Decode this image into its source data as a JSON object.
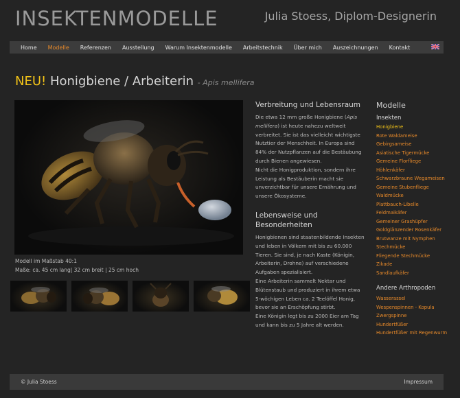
{
  "site": {
    "title": "INSEKTENMODELLE",
    "subtitle": "Julia Stoess, Diplom-Designerin"
  },
  "nav": {
    "items": [
      "Home",
      "Modelle",
      "Referenzen",
      "Ausstellung",
      "Warum Insektenmodelle",
      "Arbeitstechnik",
      "Über mich",
      "Auszeichnungen",
      "Kontakt"
    ],
    "active": "Modelle",
    "flag_icon": "uk-flag-icon"
  },
  "headline": {
    "badge": "NEU!",
    "title": "Honigbiene / Arbeiterin",
    "latin": "- Apis mellifera"
  },
  "photo": {
    "caption_scale": "Modell im Maßstab 40:1",
    "caption_size": "Maße: ca. 45 cm lang| 32 cm breit | 25 cm hoch"
  },
  "mid": {
    "s1_head": "Verbreitung und Lebensraum",
    "s1_p1_a": "Die etwa 12 mm große Honigbiene (",
    "s1_p1_i": "Apis mellifera",
    "s1_p1_b": ") ist heute nahezu weltweit verbreitet. Sie ist das vielleicht wichtigste Nutztier der Menschheit. In Europa sind 84% der Nutzpflanzen auf die Bestäubung durch Bienen angewiesen.",
    "s1_p2": "Nicht die Honigproduktion, sondern ihre Leistung als Bestäuberin macht sie unverzichtbar für unsere Ernährung und unsere Ökosysteme.",
    "s2_head": "Lebensweise und Besonderheiten",
    "s2_p1": "Honigbienen sind staatenbildende Insekten und leben in Völkern mit bis zu 60.000 Tieren. Sie sind, je nach Kaste (Königin, Arbeiterin, Drohne) auf verschiedene Aufgaben spezialisiert.",
    "s2_p2": "Eine Arbeiterin sammelt Nektar und Blütenstaub und produziert in ihrem etwa 5-wöchigen Leben ca. 2 Teelöffel Honig, bevor sie an Erschöpfung stirbt.",
    "s2_p3": "Eine Königin legt bis zu 2000 Eier am Tag und kann bis zu 5 Jahre alt werden."
  },
  "sidebar": {
    "heading": "Modelle",
    "insekten_heading": "Insekten",
    "insekten": [
      "Honigbiene",
      "Rote Waldameise",
      "Gebirgsameise",
      "Asiatische Tigermücke",
      "Gemeine Florfliege",
      "Höhlenkäfer",
      "Schwarzbraune Wegameisen",
      "Gemeine Stubenfliege",
      "Waldmücke",
      "Plattbauch-Libelle",
      "Feldmaikäfer",
      "Gemeiner Grashüpfer",
      "Goldglänzender Rosenkäfer",
      "Brutwanze mit Nymphen",
      "Stechmücke",
      "Fliegende Stechmücke",
      "Zikade",
      "Sandlaufkäfer"
    ],
    "current": "Honigbiene",
    "arthropoden_heading": "Andere Arthropoden",
    "arthropoden": [
      "Wasserassel",
      "Wespenspinnen - Kopula",
      "Zwergspinne",
      "Hundertfüßer",
      "Hundertfüßer mit Regenwurm"
    ]
  },
  "footer": {
    "copyright": "© Julia Stoess",
    "imprint": "Impressum"
  },
  "colors": {
    "accent": "#e88a2a",
    "badge": "#f2c318",
    "background": "#242424",
    "bar": "#3c3c3c"
  }
}
